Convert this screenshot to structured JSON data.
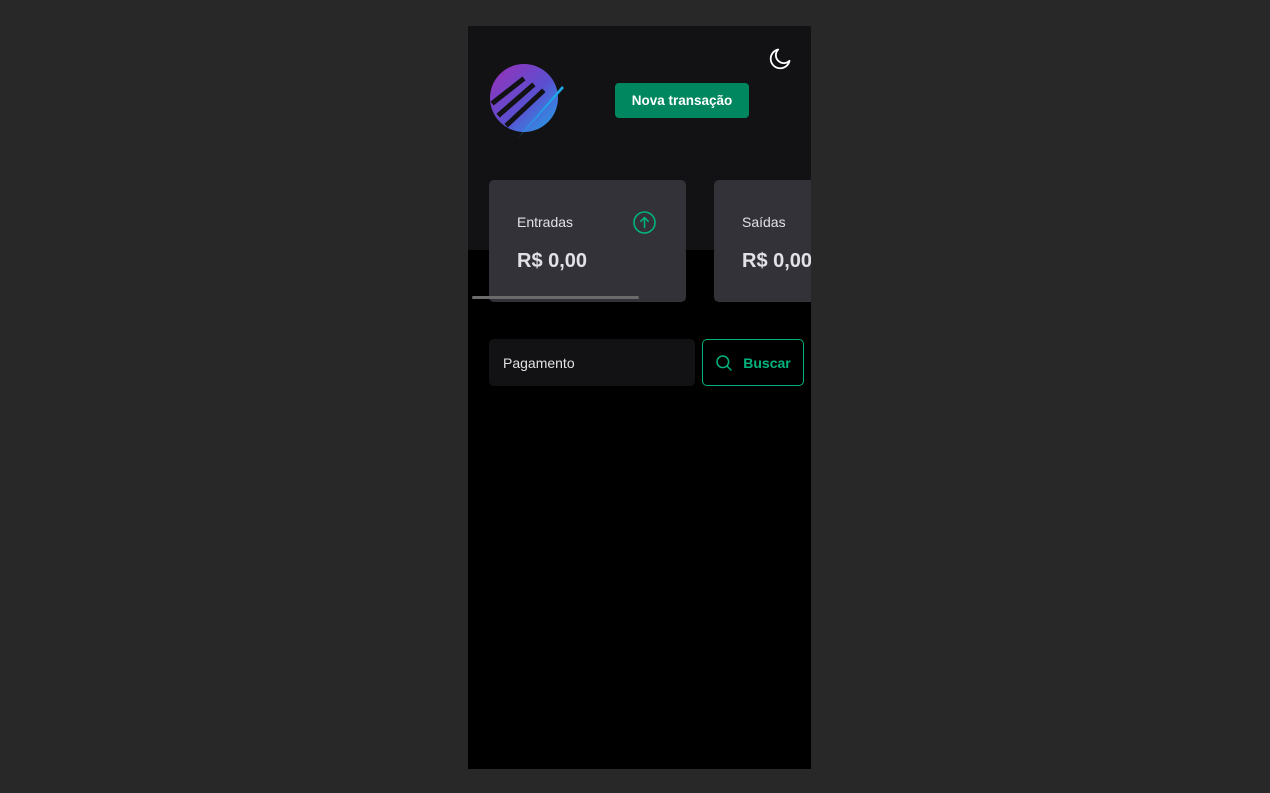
{
  "header": {
    "logo_icon": "app-logo",
    "theme_toggle_icon": "moon-icon",
    "new_transaction_label": "Nova transação"
  },
  "summary": {
    "income": {
      "title": "Entradas",
      "value": "R$ 0,00",
      "icon": "arrow-circle-up-icon",
      "icon_color": "#00b37e"
    },
    "outcome": {
      "title": "Saídas",
      "value": "R$ 0,00"
    }
  },
  "search": {
    "placeholder": "Pagamento",
    "button_label": "Buscar",
    "button_icon": "search-icon"
  },
  "colors": {
    "page_background": "#282828",
    "header_background": "#121214",
    "body_background": "#000000",
    "card_background": "#323238",
    "primary_button": "#00875f",
    "accent": "#00b37e",
    "text": "#e1e1e6"
  }
}
